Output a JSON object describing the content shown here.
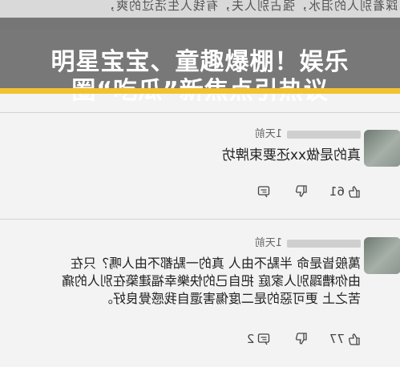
{
  "banner": {
    "line1": "明星宝宝、童趣爆棚！娱乐",
    "line2": "圈“吃瓜”新焦点引热议"
  },
  "background_text": {
    "top_line": "踩着别人的泪水，强占别人夫，有钱人生活过的爽，"
  },
  "comments": [
    {
      "time": "1天前",
      "text": "真的是做xx还要束牌坊",
      "likes": "61"
    },
    {
      "time": "1天前",
      "text_lines": [
        "萬般皆是命 半點不由人 真的一點都不由人嗎？只在",
        "由你糟蹋別人家庭 把自己的快樂幸福建築在別人的痛",
        "苦之上 更可惡的是二度傷害還自我感覺良好。"
      ],
      "likes": "77",
      "replies": "2"
    }
  ],
  "colors": {
    "banner_bg": "#6e6e6e",
    "accent": "#f2c230",
    "page_bg": "#f3f3f3"
  }
}
